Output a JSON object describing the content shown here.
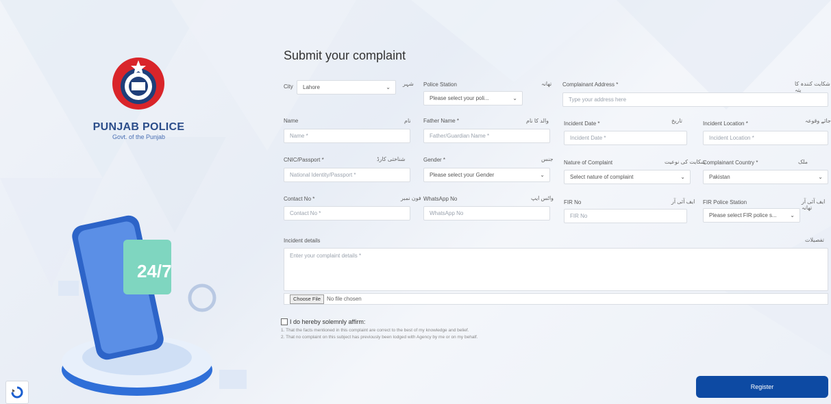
{
  "brand": {
    "name": "PUNJAB POLICE",
    "sub": "Govt. of the Punjab"
  },
  "form": {
    "title": "Submit your complaint",
    "city": {
      "label": "City",
      "value": "Lahore"
    },
    "police_station": {
      "label": "Police Station",
      "value": "Please select your poli..."
    },
    "complainant_address": {
      "label": "Complainant Address *",
      "placeholder": "Type your address here"
    },
    "name": {
      "label": "Name",
      "placeholder": "Name *"
    },
    "father_name": {
      "label": "Father Name *",
      "placeholder": "Father/Guardian Name *"
    },
    "incident_date": {
      "label": "Incident Date *",
      "placeholder": "Incident Date *"
    },
    "incident_location": {
      "label": "Incident Location *",
      "placeholder": "Incident Location *"
    },
    "cnic": {
      "label": "CNIC/Passport *",
      "placeholder": "National Identity/Passport *"
    },
    "gender": {
      "label": "Gender *",
      "value": "Please select your Gender"
    },
    "nature": {
      "label": "Nature of Complaint",
      "value": "Select nature of complaint"
    },
    "country": {
      "label": "Complainant Country *",
      "value": "Pakistan"
    },
    "contact": {
      "label": "Contact No *",
      "placeholder": "Contact No *"
    },
    "whatsapp": {
      "label": "WhatsApp No",
      "placeholder": "WhatsApp No"
    },
    "fir": {
      "label": "FIR No",
      "placeholder": "FIR No"
    },
    "fir_station": {
      "label": "FIR Police Station",
      "value": "Please select FIR police s..."
    },
    "details": {
      "label": "Incident details",
      "placeholder": "Enter your complaint details *"
    },
    "file": {
      "button": "Choose File",
      "status": "No file chosen"
    },
    "affirm": "I do hereby solemnly affirm:",
    "note1": "1. That the facts mentioned in this complaint are correct to the best of my knowledge and belief.",
    "note2": "2. That no complaint on this subject has previously been lodged with Agency by me or on my behalf.",
    "register": "Register"
  },
  "urdu": {
    "city": "شہر",
    "police_station": "تھانہ",
    "address": "شکایت کنندہ کا پتہ",
    "name": "نام",
    "father": "والد کا نام",
    "date": "تاریخ",
    "location": "جائے وقوعہ",
    "cnic": "شناختی کارڈ",
    "gender": "جنس",
    "nature": "شکایت کی نوعیت",
    "country": "ملک",
    "contact": "فون نمبر",
    "whatsapp": "واٹس ایپ",
    "fir": "ایف آئی آر",
    "fir_station": "ایف آئی آر تھانہ",
    "details": "تفصیلات"
  },
  "colors": {
    "primary": "#0d4aa3",
    "brand": "#2b4d8a"
  }
}
